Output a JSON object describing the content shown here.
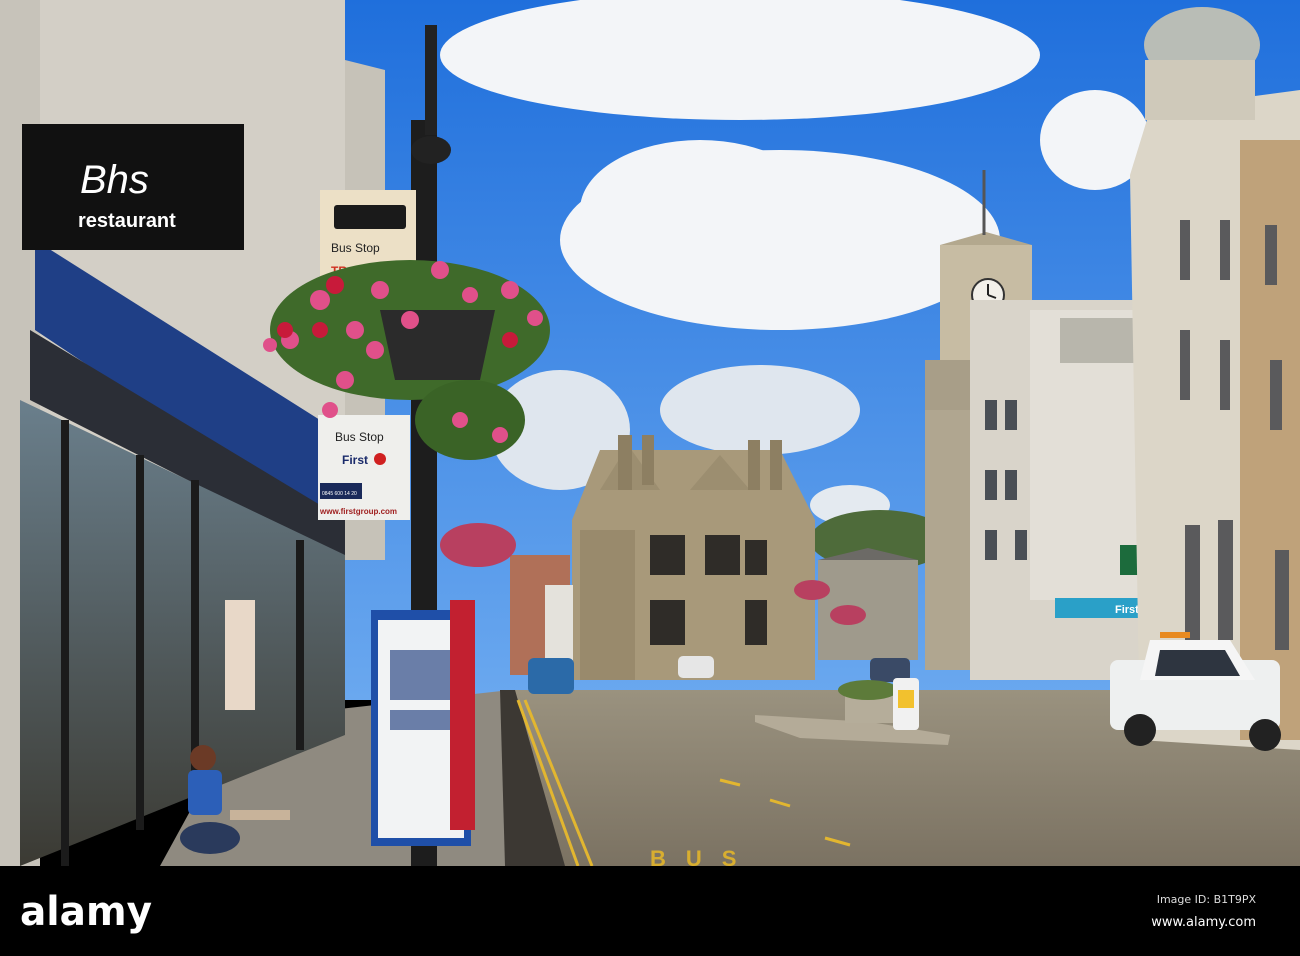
{
  "photo": {
    "shop_sign": {
      "brand": "Bhs",
      "label": "restaurant"
    },
    "bus_stop_sign_top": {
      "label": "Bus Stop",
      "partial_text": "TR"
    },
    "bus_stop_sign_lower": {
      "label": "Bus Stop",
      "operator": "First",
      "phone": "0845 600 14 20",
      "website": "www.firstgroup.com"
    },
    "shopfront_sign_right": {
      "label": "First Cl"
    },
    "road_marking": {
      "label": "BUS"
    },
    "colors": {
      "sky": "#2f7fe0",
      "stone": "#a8997a",
      "road": "#8c8474",
      "bhs_blue": "#1f3f86",
      "flowers": "#e0508a"
    }
  },
  "watermark": {
    "logo": "alamy",
    "image_id": "Image ID: B1T9PX",
    "website": "www.alamy.com"
  }
}
